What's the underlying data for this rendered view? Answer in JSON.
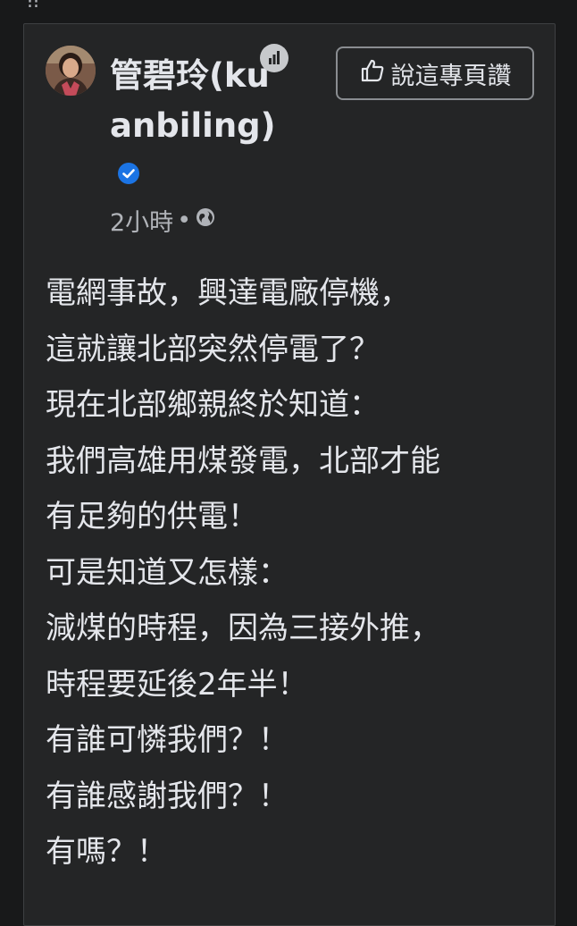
{
  "post": {
    "author": "管碧玲(kuanbiling)",
    "time": "2小時",
    "separator": "•",
    "like_page_button": "說這專頁讚",
    "lines": [
      "電網事故，興達電廠停機，",
      "這就讓北部突然停電了？",
      "現在北部鄉親終於知道：",
      "我們高雄用煤發電，北部才能",
      "有足夠的供電！",
      "可是知道又怎樣：",
      "減煤的時程，因為三接外推，",
      "時程要延後2年半！",
      "有誰可憐我們？！",
      "有誰感謝我們？！",
      "有嗎？！"
    ]
  },
  "icons": {
    "avatar": "profile-photo",
    "stats": "bar-chart-icon",
    "verified": "verified-badge-icon",
    "privacy": "globe-icon",
    "like": "thumbs-up-icon"
  },
  "colors": {
    "background": "#18191a",
    "card": "#242526",
    "text": "#e4e6eb",
    "secondary_text": "#b0b3b8",
    "verified_blue": "#1b74e4"
  }
}
